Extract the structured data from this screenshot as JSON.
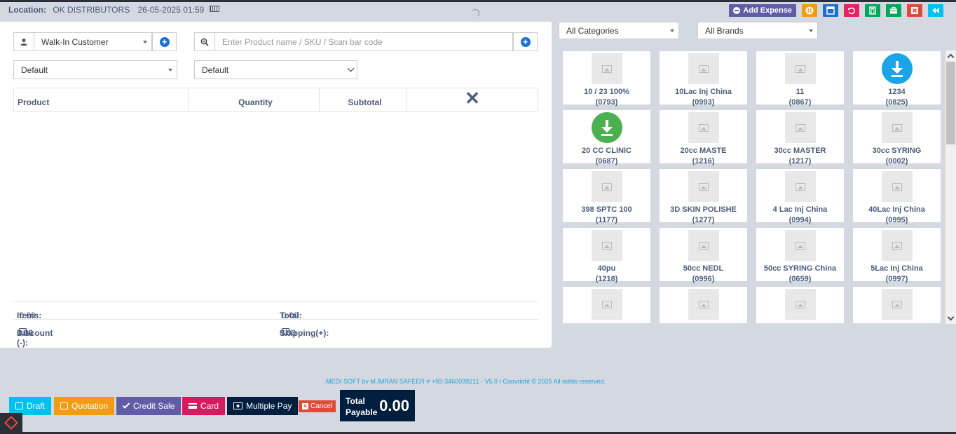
{
  "header": {
    "location_label": "Location:",
    "location_value": "OK DISTRIBUTORS",
    "datetime": "26-05-2025 01:59",
    "add_expense_label": "Add Expense",
    "colors": {
      "add_expense": "#605ca8",
      "pause": "#f39c12",
      "calculator_blue": "#1e6ecf",
      "undo": "#e91e63",
      "calc_green": "#00a65a",
      "close": "#dd4b39",
      "back": "#00c0ef"
    }
  },
  "customer": {
    "selected": "Walk-In Customer"
  },
  "search": {
    "placeholder": "Enter Product name / SKU / Scan bar code"
  },
  "price_group": {
    "selected": "Default"
  },
  "types_of_service": {
    "selected": "Default"
  },
  "cart_table": {
    "headers": {
      "product": "Product",
      "quantity": "Quantity",
      "subtotal": "Subtotal"
    }
  },
  "totals": {
    "items_label": "Items:",
    "items_value": "0.00",
    "total_label": "Total:",
    "total_value": "0.00",
    "discount_label": "Discount (-):",
    "discount_value": "0.00",
    "shipping_label": "Shipping(+):",
    "shipping_value": "0.00"
  },
  "filters": {
    "category": "All Categories",
    "brand": "All Brands"
  },
  "products": [
    {
      "name": "10 / 23 100%",
      "sku": "(0793)",
      "image": "placeholder"
    },
    {
      "name": "10Lac Inj China",
      "sku": "(0993)",
      "image": "placeholder"
    },
    {
      "name": "11",
      "sku": "(0867)",
      "image": "placeholder"
    },
    {
      "name": "1234",
      "sku": "(0825)",
      "image": "download-blue"
    },
    {
      "name": "20 CC CLINIC",
      "sku": "(0687)",
      "image": "download-green"
    },
    {
      "name": "20cc MASTE",
      "sku": "(1216)",
      "image": "placeholder"
    },
    {
      "name": "30cc MASTER",
      "sku": "(1217)",
      "image": "placeholder"
    },
    {
      "name": "30cc SYRING",
      "sku": "(0002)",
      "image": "placeholder"
    },
    {
      "name": "398 SPTC 100",
      "sku": "(1177)",
      "image": "placeholder"
    },
    {
      "name": "3D SKIN POLISHE",
      "sku": "(1277)",
      "image": "placeholder"
    },
    {
      "name": "4 Lac Inj China",
      "sku": "(0994)",
      "image": "placeholder"
    },
    {
      "name": "40Lac Inj China",
      "sku": "(0995)",
      "image": "placeholder"
    },
    {
      "name": "40pu",
      "sku": "(1218)",
      "image": "placeholder"
    },
    {
      "name": "50cc NEDL",
      "sku": "(0996)",
      "image": "placeholder"
    },
    {
      "name": "50cc SYRING China",
      "sku": "(0659)",
      "image": "placeholder"
    },
    {
      "name": "5Lac Inj China",
      "sku": "(0997)",
      "image": "placeholder"
    },
    {
      "name": "",
      "sku": "",
      "image": "placeholder"
    },
    {
      "name": "",
      "sku": "",
      "image": "placeholder"
    },
    {
      "name": "",
      "sku": "",
      "image": "placeholder"
    },
    {
      "name": "",
      "sku": "",
      "image": "placeholder"
    }
  ],
  "footer": {
    "text": "MEDI SOFT by M.IMRAN SAFEER # +92-3460039211 - V5.0 | Copyright © 2025 All rights reserved."
  },
  "actions": {
    "draft": "Draft",
    "quotation": "Quotation",
    "credit_sale": "Credit Sale",
    "card": "Card",
    "multiple_pay": "Multiple Pay",
    "cancel": "Cancel"
  },
  "payable": {
    "label_line1": "Total",
    "label_line2": "Payable",
    "amount": "0.00"
  }
}
